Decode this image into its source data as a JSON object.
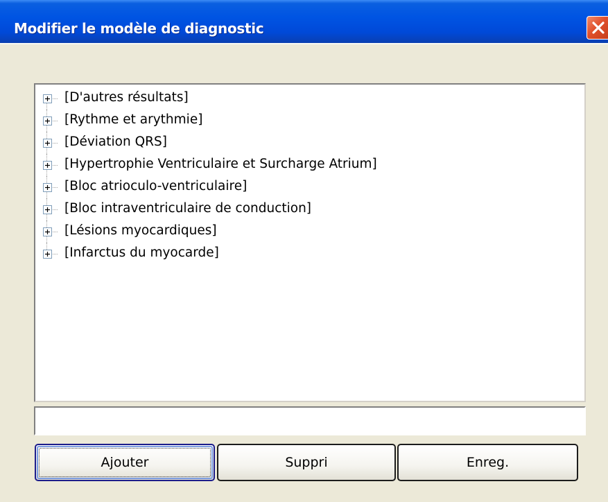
{
  "window": {
    "title": "Modifier le modèle de diagnostic"
  },
  "tree": {
    "items": [
      {
        "label": "[D'autres résultats]",
        "expander": "plus"
      },
      {
        "label": "[Rythme et arythmie]",
        "expander": "plus"
      },
      {
        "label": "[Déviation QRS]",
        "expander": "plus"
      },
      {
        "label": "[Hypertrophie Ventriculaire et Surcharge Atrium]",
        "expander": "plus"
      },
      {
        "label": "[Bloc atrioculo-ventriculaire]",
        "expander": "plus"
      },
      {
        "label": "[Bloc intraventriculaire de conduction]",
        "expander": "plus"
      },
      {
        "label": "[Lésions myocardiques]",
        "expander": "plus"
      },
      {
        "label": "[Infarctus du myocarde]",
        "expander": "plus"
      }
    ]
  },
  "input": {
    "value": "",
    "placeholder": ""
  },
  "buttons": {
    "add_label": "Ajouter",
    "delete_label": "Suppri",
    "save_label": "Enreg."
  },
  "colors": {
    "titlebar": "#0054e3",
    "window_bg": "#ece9d8",
    "close_button": "#e0502c"
  },
  "icons": {
    "close": "close-icon",
    "expander": "plus-box-icon"
  }
}
